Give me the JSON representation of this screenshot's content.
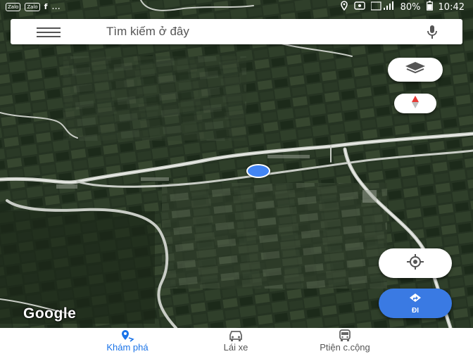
{
  "status_bar": {
    "left_badges": [
      "Zalo",
      "Zalo"
    ],
    "fb": "f",
    "dots": "...",
    "battery": "80%",
    "time": "10:42"
  },
  "search": {
    "placeholder": "Tìm kiếm ở đây"
  },
  "map": {
    "attribution": "Google"
  },
  "buttons": {
    "go_label": "ĐI"
  },
  "bottom_nav": {
    "tabs": [
      {
        "label": "Khám phá",
        "active": true,
        "icon": "explore-pin-icon"
      },
      {
        "label": "Lái xe",
        "active": false,
        "icon": "car-icon"
      },
      {
        "label": "Ptiện c.cộng",
        "active": false,
        "icon": "bus-icon"
      }
    ]
  },
  "colors": {
    "accent": "#1a73e8",
    "go_button": "#3a7ae3",
    "location_dot": "#4285f4",
    "compass_needle": "#e53935"
  }
}
